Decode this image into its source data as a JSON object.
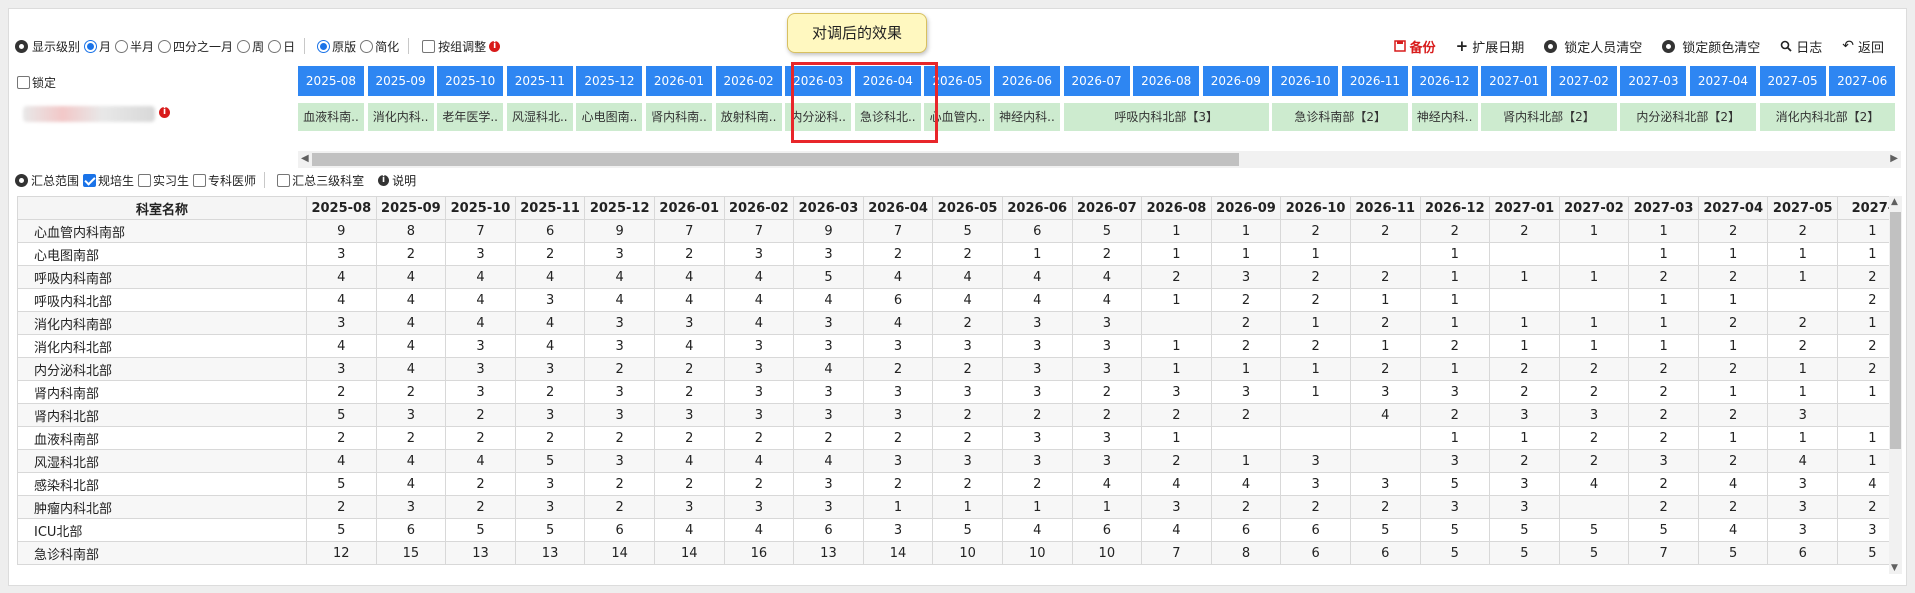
{
  "toolbar": {
    "display_level_label": "显示级别",
    "level_options": [
      "月",
      "半月",
      "四分之一月",
      "周",
      "日"
    ],
    "selected_level": "月",
    "version_options": [
      "原版",
      "简化"
    ],
    "selected_version": "原版",
    "group_adjust_label": "按组调整",
    "tooltip": "对调后的效果"
  },
  "actions": {
    "backup": "备份",
    "extend_date": "扩展日期",
    "lock_person_clear": "锁定人员清空",
    "lock_color_clear": "锁定颜色清空",
    "log": "日志",
    "back": "返回"
  },
  "lock_label": "锁定",
  "months": [
    "2025-08",
    "2025-09",
    "2025-10",
    "2025-11",
    "2025-12",
    "2026-01",
    "2026-02",
    "2026-03",
    "2026-04",
    "2026-05",
    "2026-06",
    "2026-07",
    "2026-08",
    "2026-09",
    "2026-10",
    "2026-11",
    "2026-12",
    "2027-01",
    "2027-02",
    "2027-03",
    "2027-04",
    "2027-05",
    "2027-06"
  ],
  "dept_chips": [
    {
      "label": "血液科南..",
      "span": 1
    },
    {
      "label": "消化内科..",
      "span": 1
    },
    {
      "label": "老年医学..",
      "span": 1
    },
    {
      "label": "风湿科北..",
      "span": 1
    },
    {
      "label": "心电图南..",
      "span": 1
    },
    {
      "label": "肾内科南..",
      "span": 1
    },
    {
      "label": "放射科南..",
      "span": 1
    },
    {
      "label": "内分泌科..",
      "span": 1
    },
    {
      "label": "急诊科北..",
      "span": 1
    },
    {
      "label": "心血管内..",
      "span": 1
    },
    {
      "label": "神经内科..",
      "span": 1
    },
    {
      "label": "呼吸内科北部【3】",
      "span": 3
    },
    {
      "label": "急诊科南部【2】",
      "span": 2
    },
    {
      "label": "神经内科..",
      "span": 1
    },
    {
      "label": "肾内科北部【2】",
      "span": 2
    },
    {
      "label": "内分泌科北部【2】",
      "span": 2
    },
    {
      "label": "消化内科北部【2】",
      "span": 2
    }
  ],
  "summary": {
    "range_label": "汇总范围",
    "trainee_options": [
      {
        "label": "规培生",
        "checked": true
      },
      {
        "label": "实习生",
        "checked": false
      },
      {
        "label": "专科医师",
        "checked": false
      }
    ],
    "third_level_label": "汇总三级科室",
    "explain_label": "说明"
  },
  "table": {
    "dept_header": "科室名称",
    "headers": [
      "2025-08",
      "2025-09",
      "2025-10",
      "2025-11",
      "2025-12",
      "2026-01",
      "2026-02",
      "2026-03",
      "2026-04",
      "2026-05",
      "2026-06",
      "2026-07",
      "2026-08",
      "2026-09",
      "2026-10",
      "2026-11",
      "2026-12",
      "2027-01",
      "2027-02",
      "2027-03",
      "2027-04",
      "2027-05",
      "2027-"
    ],
    "rows": [
      {
        "dept": "心血管内科南部",
        "values": [
          "9",
          "8",
          "7",
          "6",
          "9",
          "7",
          "7",
          "9",
          "7",
          "5",
          "6",
          "5",
          "1",
          "1",
          "2",
          "2",
          "2",
          "2",
          "1",
          "1",
          "2",
          "2",
          "1"
        ]
      },
      {
        "dept": "心电图南部",
        "values": [
          "3",
          "2",
          "3",
          "2",
          "3",
          "2",
          "3",
          "3",
          "2",
          "2",
          "1",
          "2",
          "1",
          "1",
          "1",
          "",
          "1",
          "",
          "",
          "1",
          "1",
          "1",
          "1"
        ]
      },
      {
        "dept": "呼吸内科南部",
        "values": [
          "4",
          "4",
          "4",
          "4",
          "4",
          "4",
          "4",
          "5",
          "4",
          "4",
          "4",
          "4",
          "2",
          "3",
          "2",
          "2",
          "1",
          "1",
          "1",
          "2",
          "2",
          "1",
          "2"
        ]
      },
      {
        "dept": "呼吸内科北部",
        "values": [
          "4",
          "4",
          "4",
          "3",
          "4",
          "4",
          "4",
          "4",
          "6",
          "4",
          "4",
          "4",
          "1",
          "2",
          "2",
          "1",
          "1",
          "",
          "",
          "1",
          "1",
          "",
          "2"
        ]
      },
      {
        "dept": "消化内科南部",
        "values": [
          "3",
          "4",
          "4",
          "4",
          "3",
          "3",
          "4",
          "3",
          "4",
          "2",
          "3",
          "3",
          "",
          "2",
          "1",
          "2",
          "1",
          "1",
          "1",
          "1",
          "2",
          "2",
          "1"
        ]
      },
      {
        "dept": "消化内科北部",
        "values": [
          "4",
          "4",
          "3",
          "4",
          "3",
          "4",
          "3",
          "3",
          "3",
          "3",
          "3",
          "3",
          "1",
          "2",
          "2",
          "1",
          "2",
          "1",
          "1",
          "1",
          "1",
          "2",
          "2"
        ]
      },
      {
        "dept": "内分泌科北部",
        "values": [
          "3",
          "4",
          "3",
          "3",
          "2",
          "2",
          "3",
          "4",
          "2",
          "2",
          "3",
          "3",
          "1",
          "1",
          "1",
          "2",
          "1",
          "2",
          "2",
          "2",
          "2",
          "1",
          "2"
        ]
      },
      {
        "dept": "肾内科南部",
        "values": [
          "2",
          "2",
          "3",
          "2",
          "3",
          "2",
          "3",
          "3",
          "3",
          "3",
          "3",
          "2",
          "3",
          "3",
          "1",
          "3",
          "3",
          "2",
          "2",
          "2",
          "1",
          "1",
          "1"
        ]
      },
      {
        "dept": "肾内科北部",
        "values": [
          "5",
          "3",
          "2",
          "3",
          "3",
          "3",
          "3",
          "3",
          "3",
          "2",
          "2",
          "2",
          "2",
          "2",
          "",
          "4",
          "2",
          "3",
          "3",
          "2",
          "2",
          "3",
          ""
        ]
      },
      {
        "dept": "血液科南部",
        "values": [
          "2",
          "2",
          "2",
          "2",
          "2",
          "2",
          "2",
          "2",
          "2",
          "2",
          "3",
          "3",
          "1",
          "",
          "",
          "",
          "1",
          "1",
          "2",
          "2",
          "1",
          "1",
          "1"
        ]
      },
      {
        "dept": "风湿科北部",
        "values": [
          "4",
          "4",
          "4",
          "5",
          "3",
          "4",
          "4",
          "4",
          "3",
          "3",
          "3",
          "3",
          "2",
          "1",
          "3",
          "",
          "3",
          "2",
          "2",
          "3",
          "2",
          "4",
          "1"
        ]
      },
      {
        "dept": "感染科北部",
        "values": [
          "5",
          "4",
          "2",
          "3",
          "2",
          "2",
          "2",
          "3",
          "2",
          "2",
          "2",
          "4",
          "4",
          "4",
          "3",
          "3",
          "5",
          "3",
          "4",
          "2",
          "4",
          "3",
          "4"
        ]
      },
      {
        "dept": "肿瘤内科北部",
        "values": [
          "2",
          "3",
          "2",
          "3",
          "2",
          "3",
          "3",
          "3",
          "1",
          "1",
          "1",
          "1",
          "3",
          "2",
          "2",
          "2",
          "3",
          "3",
          "",
          "2",
          "2",
          "3",
          "2"
        ]
      },
      {
        "dept": "ICU北部",
        "values": [
          "5",
          "6",
          "5",
          "5",
          "6",
          "4",
          "4",
          "6",
          "3",
          "5",
          "4",
          "6",
          "4",
          "6",
          "6",
          "5",
          "5",
          "5",
          "5",
          "5",
          "4",
          "3",
          "3"
        ]
      },
      {
        "dept": "急诊科南部",
        "values": [
          "12",
          "15",
          "13",
          "13",
          "14",
          "14",
          "16",
          "13",
          "14",
          "10",
          "10",
          "10",
          "7",
          "8",
          "6",
          "6",
          "5",
          "5",
          "5",
          "7",
          "5",
          "6",
          "5"
        ]
      }
    ]
  }
}
